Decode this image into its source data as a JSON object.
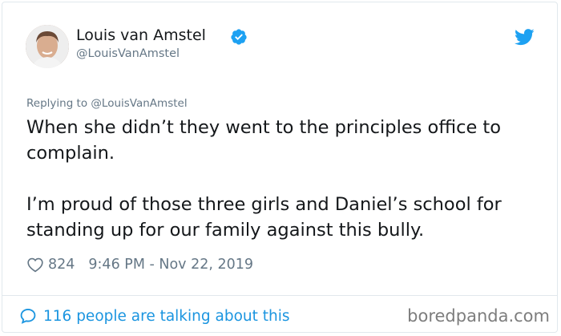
{
  "author": {
    "display_name": "Louis van Amstel",
    "handle": "@LouisVanAmstel",
    "verified": true
  },
  "reply": {
    "prefix": "Replying to",
    "mention": "@LouisVanAmstel"
  },
  "tweet": {
    "paragraph_1": "When she didn’t they went to the principles office to complain.",
    "paragraph_2": "I’m proud of those three girls and Daniel’s school for standing up for our family against this bully."
  },
  "meta": {
    "like_count": "824",
    "timestamp": "9:46 PM - Nov 22, 2019"
  },
  "footer": {
    "talking_label": "116 people are talking about this"
  },
  "watermark": "boredpanda.com",
  "colors": {
    "twitter_blue": "#1da1f2",
    "link_blue": "#1b95e0",
    "secondary_text": "#657786",
    "primary_text": "#14171a",
    "border": "#e1e8ed"
  },
  "icons": {
    "verified": "verified-badge-icon",
    "bird": "twitter-bird-icon",
    "like": "heart-outline-icon",
    "talking": "speech-bubble-icon"
  }
}
